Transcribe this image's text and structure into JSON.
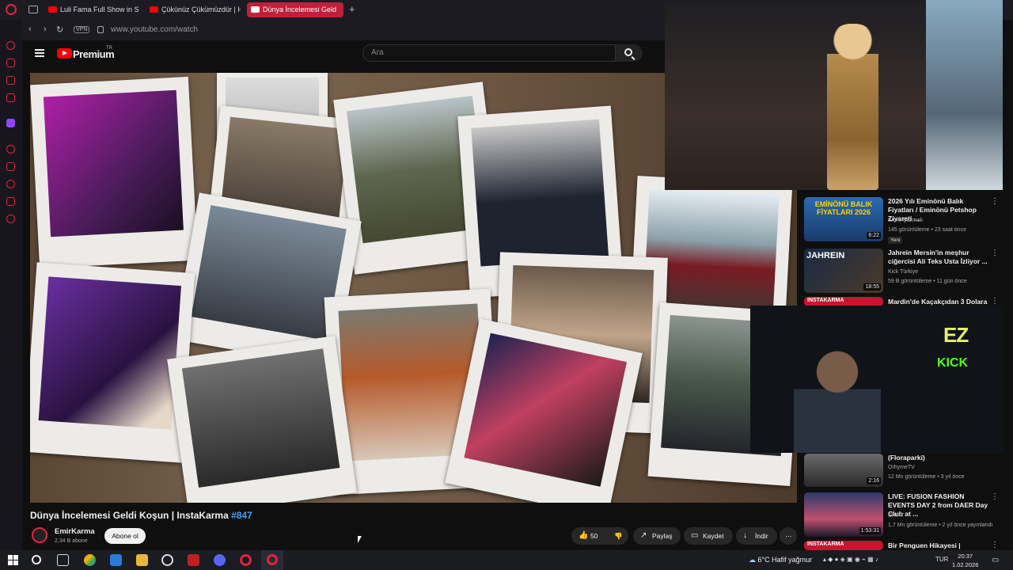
{
  "browser": {
    "tabs": [
      {
        "label": "Luli Fama Full Show in SLO"
      },
      {
        "label": "Çükünüz Çükümüzdür | H"
      },
      {
        "label": "Dünya İncelemesi Geld"
      }
    ],
    "vpn_label": "VPN",
    "url": "www.youtube.com/watch"
  },
  "youtube": {
    "brand": "Premium",
    "region": "TR",
    "search_placeholder": "Ara"
  },
  "video": {
    "title": "Dünya İncelemesi Geldi Koşun | InstaKarma",
    "episode": "#847",
    "channel": "EmirKarma",
    "subscribers": "2,34 B abone",
    "subscribe_label": "Abone ol",
    "likes": "50",
    "share_label": "Paylaş",
    "save_label": "Kaydet",
    "download_label": "İndir"
  },
  "recommendations": [
    {
      "title": "2026 Yılı Eminönü Balık Fiyatları / Eminönü Petshop Ziyareti ...",
      "channel": "Emre Çakmak",
      "meta": "145 görüntüleme • 23 saat önce",
      "badge": "Yeni",
      "duration": "6:22",
      "thumb_text": "EMİNÖNÜ BALIK FİYATLARI 2026"
    },
    {
      "title": "Jahrein Mersin'in meşhur ciğercisi Ali Teks Usta İzliyor ...",
      "channel": "Kick Türkiye",
      "meta": "59 B görüntüleme • 11 gün önce",
      "duration": "18:55",
      "thumb_text": "JAHREIN"
    },
    {
      "title": "Mardin'de Kaçakçıdan 3 Dolara",
      "thumb_text": "INSTAKARMA"
    },
    {
      "title": "(Floraparki)",
      "channel": "OrhymeTV",
      "meta": "12 Mn görüntüleme • 3 yıl önce",
      "duration": "2:16"
    },
    {
      "title": "LIVE: FUSION FASHION EVENTS DAY 2 from DAER Day Club at ...",
      "channel": "SHIFT",
      "meta": "1,7 Mn görüntüleme • 2 yıl önce yayınlandı",
      "duration": "1:53:31"
    },
    {
      "title": "Bir Penguen Hikayesi |",
      "thumb_text": "INSTAKARMA"
    }
  ],
  "overlay": {
    "ez": "EZ",
    "kick": "KICK"
  },
  "taskbar": {
    "weather": "6°C  Hafif yağmur",
    "lang": "TUR",
    "time": "20:37",
    "date": "1.02.2026"
  }
}
